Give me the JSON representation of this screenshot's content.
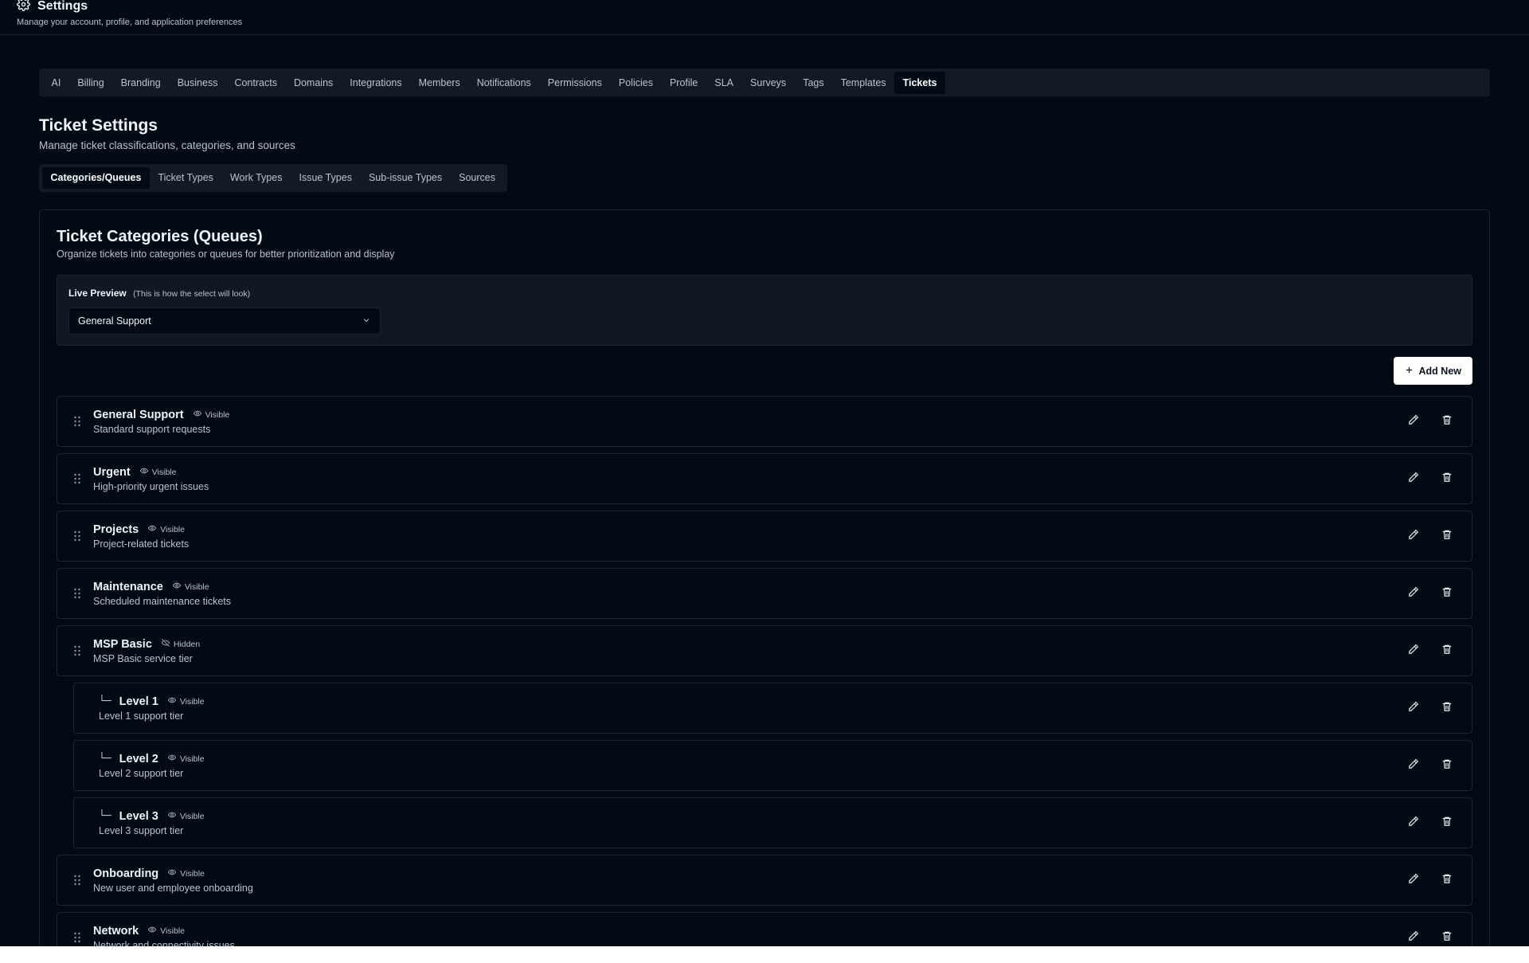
{
  "header": {
    "icon": "gear-icon",
    "title": "Settings",
    "subtitle": "Manage your account, profile, and application preferences"
  },
  "tabs": [
    "AI",
    "Billing",
    "Branding",
    "Business",
    "Contracts",
    "Domains",
    "Integrations",
    "Members",
    "Notifications",
    "Permissions",
    "Policies",
    "Profile",
    "SLA",
    "Surveys",
    "Tags",
    "Templates",
    "Tickets"
  ],
  "active_tab": "Tickets",
  "page": {
    "title": "Ticket Settings",
    "subtitle": "Manage ticket classifications, categories, and sources"
  },
  "subtabs": [
    "Categories/Queues",
    "Ticket Types",
    "Work Types",
    "Issue Types",
    "Sub-issue Types",
    "Sources"
  ],
  "active_subtab": "Categories/Queues",
  "card": {
    "title": "Ticket Categories (Queues)",
    "subtitle": "Organize tickets into categories or queues for better prioritization and display"
  },
  "preview": {
    "label": "Live Preview",
    "hint": "(This is how the select will look)",
    "selected": "General Support"
  },
  "add_button_label": "Add New",
  "categories": [
    {
      "name": "General Support",
      "status": "Visible",
      "desc": "Standard support requests",
      "child": false
    },
    {
      "name": "Urgent",
      "status": "Visible",
      "desc": "High-priority urgent issues",
      "child": false
    },
    {
      "name": "Projects",
      "status": "Visible",
      "desc": "Project-related tickets",
      "child": false
    },
    {
      "name": "Maintenance",
      "status": "Visible",
      "desc": "Scheduled maintenance tickets",
      "child": false
    },
    {
      "name": "MSP Basic",
      "status": "Hidden",
      "desc": "MSP Basic service tier",
      "child": false
    },
    {
      "name": "Level 1",
      "status": "Visible",
      "desc": "Level 1 support tier",
      "child": true
    },
    {
      "name": "Level 2",
      "status": "Visible",
      "desc": "Level 2 support tier",
      "child": true
    },
    {
      "name": "Level 3",
      "status": "Visible",
      "desc": "Level 3 support tier",
      "child": true
    },
    {
      "name": "Onboarding",
      "status": "Visible",
      "desc": "New user and employee onboarding",
      "child": false
    },
    {
      "name": "Network",
      "status": "Visible",
      "desc": "Network and connectivity issues",
      "child": false
    }
  ]
}
